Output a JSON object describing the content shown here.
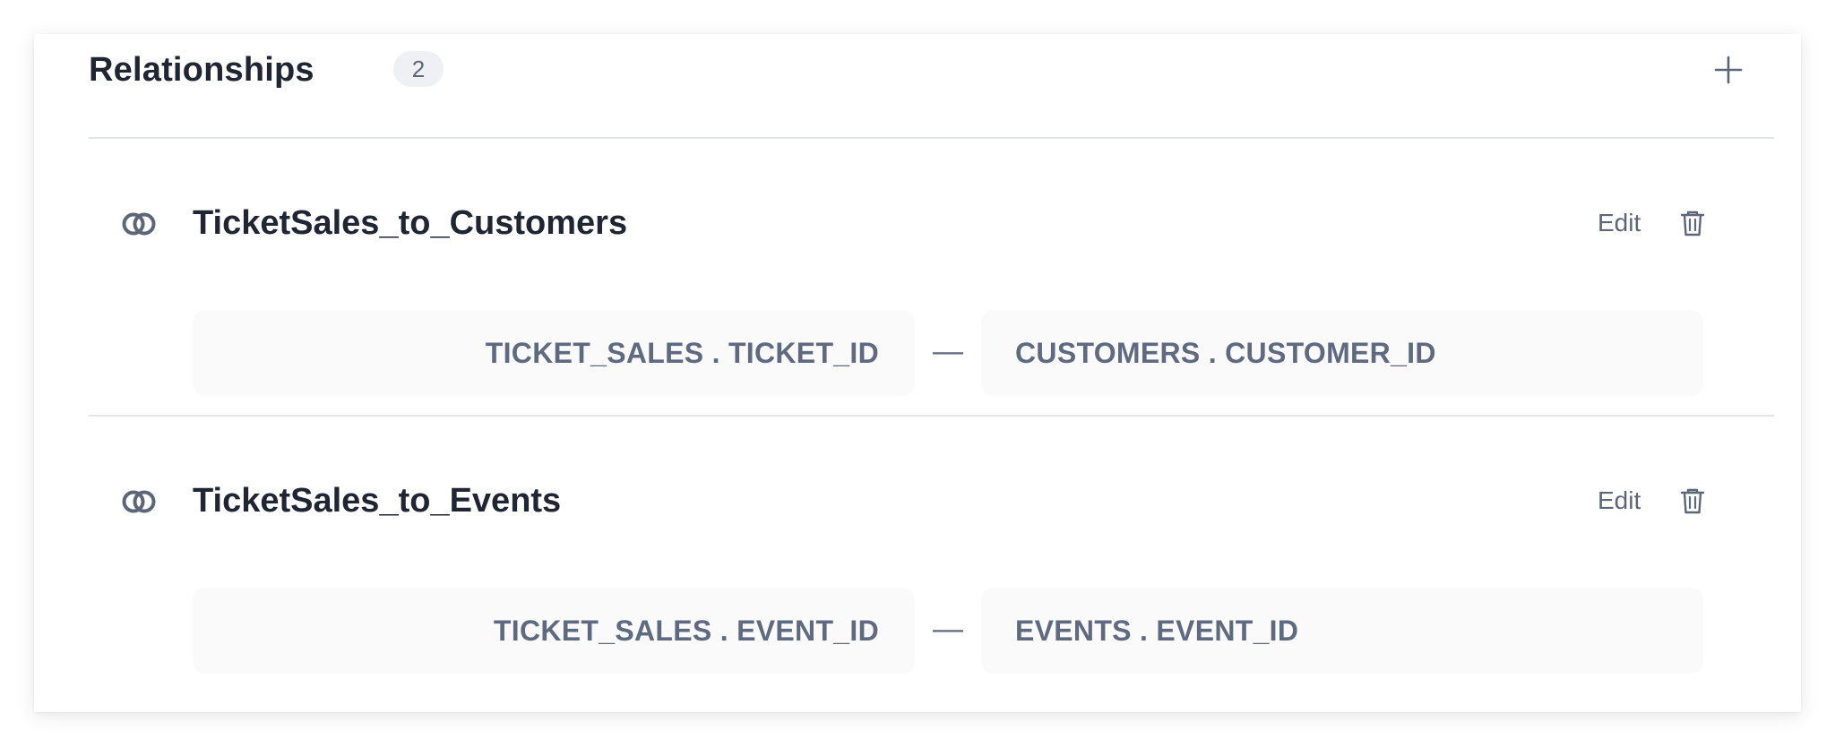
{
  "header": {
    "title": "Relationships",
    "count": "2"
  },
  "relationships": [
    {
      "name": "TicketSales_to_Customers",
      "edit_label": "Edit",
      "left_field": "TICKET_SALES . TICKET_ID",
      "connector": "—",
      "right_field": "CUSTOMERS . CUSTOMER_ID"
    },
    {
      "name": "TicketSales_to_Events",
      "edit_label": "Edit",
      "left_field": "TICKET_SALES . EVENT_ID",
      "connector": "—",
      "right_field": "EVENTS . EVENT_ID"
    }
  ],
  "icons": {
    "add": "plus-icon",
    "relationship": "link-rings-icon",
    "delete": "trash-icon"
  },
  "colors": {
    "text_primary": "#1f2533",
    "text_secondary": "#5f6a80",
    "divider": "#e1e3ea",
    "field_background": "#fafafb",
    "badge_background": "#eef0f4"
  }
}
